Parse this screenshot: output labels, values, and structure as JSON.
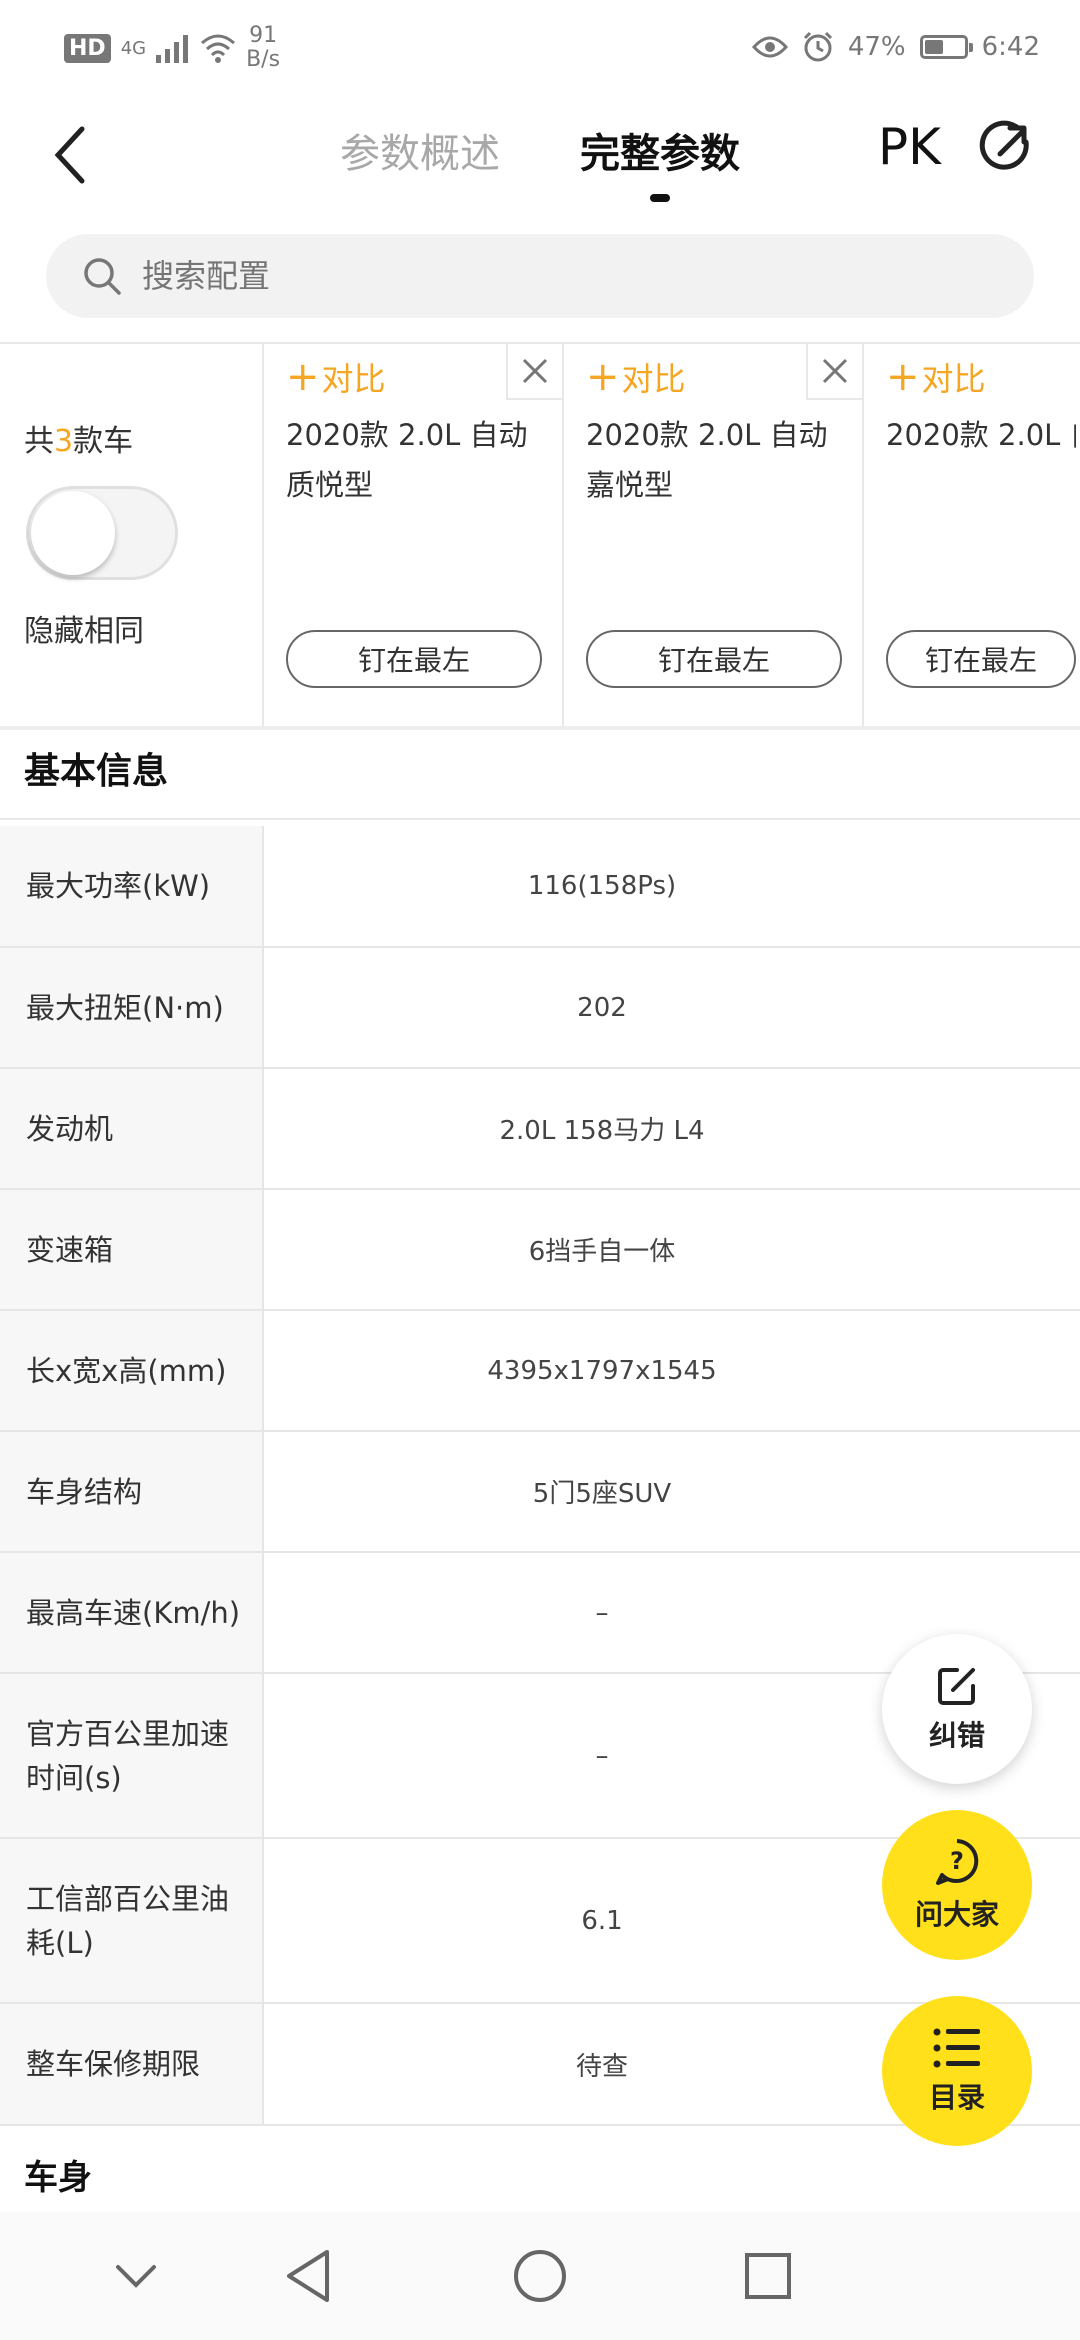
{
  "status_bar": {
    "hd": "HD",
    "network": "4G",
    "speed_value": "91",
    "speed_unit": "B/s",
    "battery_percent": "47%",
    "battery_level": 0.47,
    "time": "6:42"
  },
  "header": {
    "back_icon": "chevron-left-icon",
    "tabs": [
      {
        "label": "参数概述",
        "active": false
      },
      {
        "label": "完整参数",
        "active": true
      }
    ],
    "pk_label": "PK",
    "share_icon": "share-icon"
  },
  "search": {
    "placeholder": "搜索配置"
  },
  "compare": {
    "count_prefix": "共",
    "count_number": "3",
    "count_suffix": "款车",
    "hide_same_label": "隐藏相同",
    "toggle_on": false,
    "cars": [
      {
        "add_label": "对比",
        "name": "2020款 2.0L 自动质悦型",
        "pin_label": "钉在最左"
      },
      {
        "add_label": "对比",
        "name": "2020款 2.0L 自动嘉悦型",
        "pin_label": "钉在最左"
      },
      {
        "add_label": "对比",
        "name": "2020款 2.0L 自动",
        "pin_label": "钉在最左"
      }
    ]
  },
  "sections": {
    "basic_title": "基本信息",
    "body_title": "车身"
  },
  "params": [
    {
      "label": "最大功率(kW)",
      "value": "116(158Ps)"
    },
    {
      "label": "最大扭矩(N·m)",
      "value": "202"
    },
    {
      "label": "发动机",
      "value": "2.0L 158马力 L4"
    },
    {
      "label": "变速箱",
      "value": "6挡手自一体"
    },
    {
      "label": "长x宽x高(mm)",
      "value": "4395x1797x1545"
    },
    {
      "label": "车身结构",
      "value": "5门5座SUV"
    },
    {
      "label": "最高车速(Km/h)",
      "value": "–"
    },
    {
      "label": "官方百公里加速时间(s)",
      "value": "–"
    },
    {
      "label": "工信部百公里油耗(L)",
      "value": "6.1"
    },
    {
      "label": "整车保修期限",
      "value": "待查"
    }
  ],
  "fabs": {
    "correct_label": "纠错",
    "ask_label": "问大家",
    "catalog_label": "目录"
  },
  "colors": {
    "accent": "#f5a623",
    "fab_yellow": "#ffe01b"
  }
}
